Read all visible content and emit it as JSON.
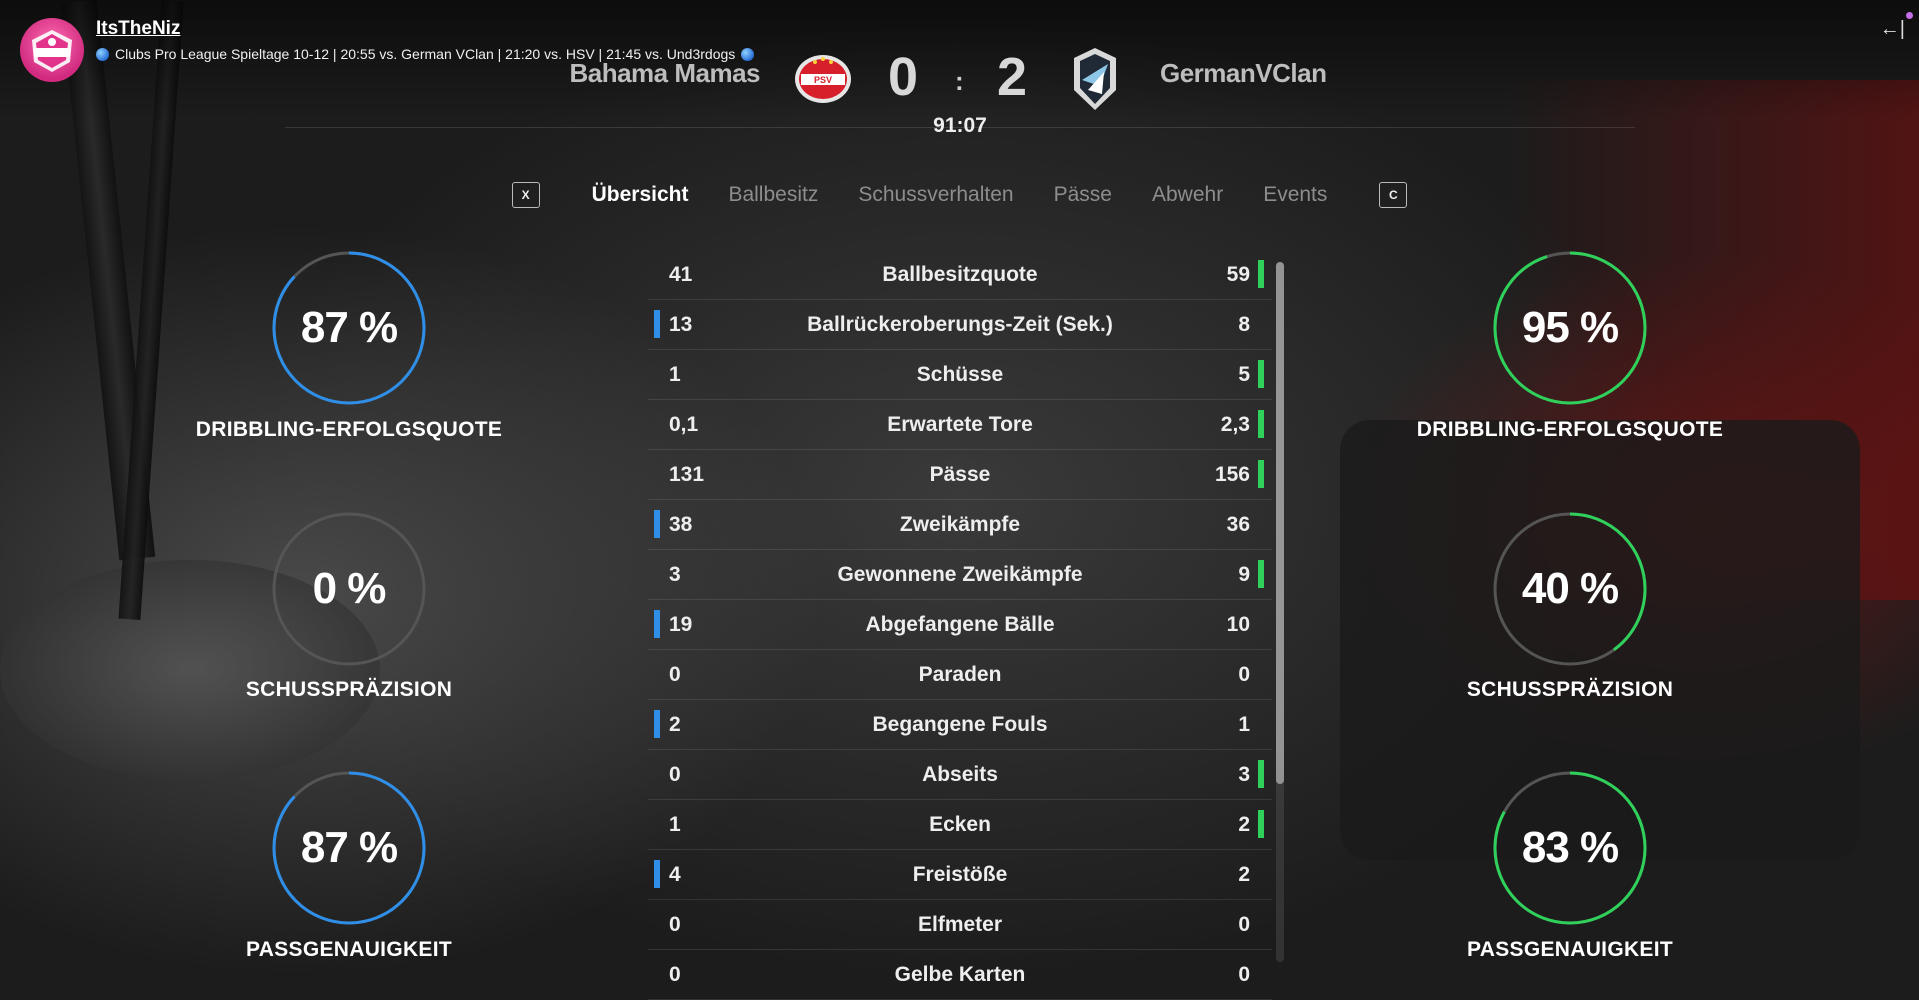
{
  "stream": {
    "channel_name": "ItsTheNiz",
    "title": "Clubs Pro League Spieltage 10-12 | 20:55 vs. German VClan | 21:20 vs. HSV | 21:45 vs. Und3rdogs",
    "collapse_icon": "←|"
  },
  "match": {
    "home_team": "Bahama Mamas",
    "away_team": "GermanVClan",
    "home_score": "0",
    "away_score": "2",
    "separator": ":",
    "clock": "91:07"
  },
  "tabs": {
    "prev_key": "X",
    "next_key": "C",
    "items": [
      "Übersicht",
      "Ballbesitz",
      "Schussverhalten",
      "Pässe",
      "Abwehr",
      "Events"
    ],
    "active_index": 0
  },
  "home_gauges": [
    {
      "value": "87 %",
      "fraction": 0.87,
      "label": "DRIBBLING-ERFOLGSQUOTE"
    },
    {
      "value": "0 %",
      "fraction": 0.0,
      "label": "SCHUSSPRÄZISION"
    },
    {
      "value": "87 %",
      "fraction": 0.87,
      "label": "PASSGENAUIGKEIT"
    }
  ],
  "away_gauges": [
    {
      "value": "95 %",
      "fraction": 0.95,
      "label": "DRIBBLING-ERFOLGSQUOTE"
    },
    {
      "value": "40 %",
      "fraction": 0.4,
      "label": "SCHUSSPRÄZISION"
    },
    {
      "value": "83 %",
      "fraction": 0.83,
      "label": "PASSGENAUIGKEIT"
    }
  ],
  "stats": [
    {
      "home": "41",
      "label": "Ballbesitzquote",
      "away": "59",
      "leader": "away"
    },
    {
      "home": "13",
      "label": "Ballrückeroberungs-Zeit (Sek.)",
      "away": "8",
      "leader": "home"
    },
    {
      "home": "1",
      "label": "Schüsse",
      "away": "5",
      "leader": "away"
    },
    {
      "home": "0,1",
      "label": "Erwartete Tore",
      "away": "2,3",
      "leader": "away"
    },
    {
      "home": "131",
      "label": "Pässe",
      "away": "156",
      "leader": "away"
    },
    {
      "home": "38",
      "label": "Zweikämpfe",
      "away": "36",
      "leader": "home"
    },
    {
      "home": "3",
      "label": "Gewonnene Zweikämpfe",
      "away": "9",
      "leader": "away"
    },
    {
      "home": "19",
      "label": "Abgefangene Bälle",
      "away": "10",
      "leader": "home"
    },
    {
      "home": "0",
      "label": "Paraden",
      "away": "0",
      "leader": "none"
    },
    {
      "home": "2",
      "label": "Begangene Fouls",
      "away": "1",
      "leader": "home"
    },
    {
      "home": "0",
      "label": "Abseits",
      "away": "3",
      "leader": "away"
    },
    {
      "home": "1",
      "label": "Ecken",
      "away": "2",
      "leader": "away"
    },
    {
      "home": "4",
      "label": "Freistöße",
      "away": "2",
      "leader": "home"
    },
    {
      "home": "0",
      "label": "Elfmeter",
      "away": "0",
      "leader": "none"
    },
    {
      "home": "0",
      "label": "Gelbe Karten",
      "away": "0",
      "leader": "none"
    }
  ],
  "colors": {
    "home_accent": "#2f8fe8",
    "away_accent": "#2fd15a",
    "gauge_track": "#555555"
  }
}
